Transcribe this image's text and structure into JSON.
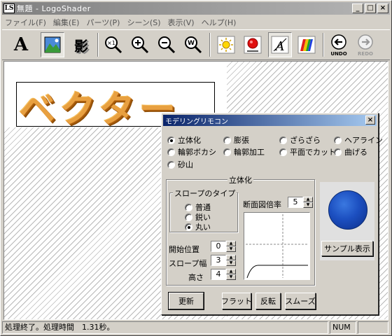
{
  "window": {
    "title": "無題 - LogoShader",
    "icon_text": "LS"
  },
  "menu": [
    "ファイル(F)",
    "編集(E)",
    "パーツ(P)",
    "シーン(S)",
    "表示(V)",
    "ヘルプ(H)"
  ],
  "toolbar": {
    "undo_label": "UNDO",
    "redo_label": "REDO",
    "text_tool_glyph": "A",
    "shadow_tool_glyph": "影",
    "zoom_reset_glyph": "×1",
    "zoom_fit_glyph": "W"
  },
  "canvas": {
    "logo_text": "ベクター"
  },
  "dialog": {
    "title": "モデリングリモコン",
    "close": "×",
    "modes": [
      {
        "label": "立体化",
        "selected": true
      },
      {
        "label": "膨張",
        "selected": false
      },
      {
        "label": "ざらざら",
        "selected": false
      },
      {
        "label": "ヘアライン",
        "selected": false
      },
      {
        "label": "輪郭ボカシ",
        "selected": false
      },
      {
        "label": "輪郭加工",
        "selected": false
      },
      {
        "label": "平面でカット",
        "selected": false
      },
      {
        "label": "曲げる",
        "selected": false
      },
      {
        "label": "砂山",
        "selected": false
      }
    ],
    "section_title": "立体化",
    "slope_group": {
      "label": "スロープのタイプ",
      "options": [
        {
          "label": "普通",
          "selected": false
        },
        {
          "label": "鋭い",
          "selected": false
        },
        {
          "label": "丸い",
          "selected": true
        }
      ]
    },
    "section_ratio_label": "断面図倍率",
    "section_ratio_value": "5",
    "start_pos_label": "開始位置",
    "start_pos_value": "0",
    "slope_width_label": "スロープ幅",
    "slope_width_value": "3",
    "height_label": "高さ",
    "height_value": "4",
    "sample_button": "サンプル表示",
    "update_button": "更新",
    "flat_button": "フラット",
    "invert_button": "反転",
    "smooth_button": "スムーズ",
    "sample_color": "#1c4fc0"
  },
  "status": {
    "message": "処理終了。処理時間　1.31秒。",
    "num": "NUM"
  }
}
